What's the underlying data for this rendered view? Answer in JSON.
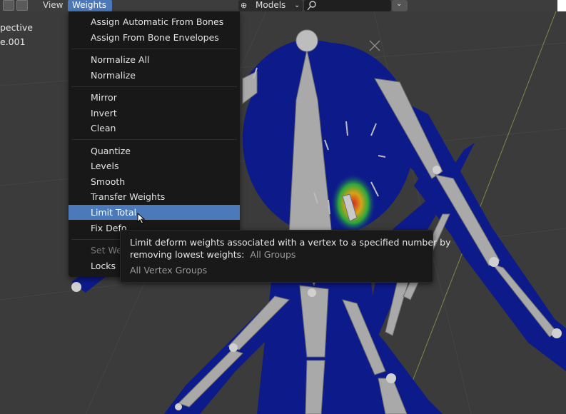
{
  "header": {
    "view_label": "View",
    "weights_label": "Weights",
    "models_label": "Models"
  },
  "overlay": {
    "line1": "pective",
    "line2": "e.001"
  },
  "menu": {
    "items": [
      {
        "label": "Assign Automatic From Bones"
      },
      {
        "label": "Assign From Bone Envelopes"
      },
      {
        "label": "Normalize All"
      },
      {
        "label": "Normalize"
      },
      {
        "label": "Mirror"
      },
      {
        "label": "Invert"
      },
      {
        "label": "Clean"
      },
      {
        "label": "Quantize"
      },
      {
        "label": "Levels"
      },
      {
        "label": "Smooth"
      },
      {
        "label": "Transfer Weights"
      },
      {
        "label": "Limit Total"
      },
      {
        "label": "Fix Defo"
      },
      {
        "label": "Set We"
      },
      {
        "label": "Locks"
      }
    ]
  },
  "tooltip": {
    "line1": "Limit deform weights associated with a vertex to a specified number by",
    "line2_prefix": "removing lowest weights:",
    "line2_value": "All Groups",
    "line3": "All Vertex Groups"
  },
  "colors": {
    "menu_highlight": "#4b79ba",
    "mesh_blue": "#0d1a8a",
    "bone_gray": "#a8a8a8"
  },
  "icons": [
    "editor-type-icon",
    "chevron-down-icon",
    "search-icon",
    "mouse-pointer-icon"
  ]
}
